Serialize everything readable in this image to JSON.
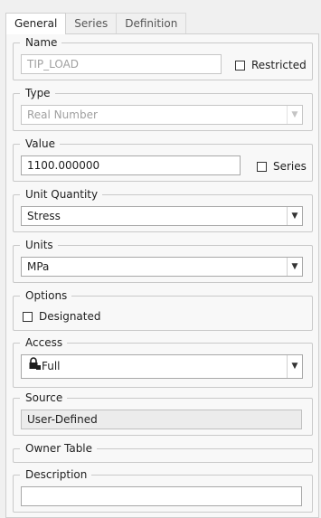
{
  "tabs": [
    "General",
    "Series",
    "Definition"
  ],
  "name": {
    "label": "Name",
    "value": "TIP_LOAD",
    "restricted_label": "Restricted"
  },
  "type": {
    "label": "Type",
    "value": "Real Number"
  },
  "value": {
    "label": "Value",
    "value": "1100.000000",
    "series_label": "Series"
  },
  "unit_quantity": {
    "label": "Unit Quantity",
    "value": "Stress"
  },
  "units": {
    "label": "Units",
    "value": "MPa"
  },
  "options": {
    "label": "Options",
    "designated_label": "Designated"
  },
  "access": {
    "label": "Access",
    "value": "Full",
    "icon": "lock-icon"
  },
  "source": {
    "label": "Source",
    "value": "User-Defined"
  },
  "owner_table": {
    "label": "Owner Table"
  },
  "description": {
    "label": "Description",
    "value": ""
  }
}
